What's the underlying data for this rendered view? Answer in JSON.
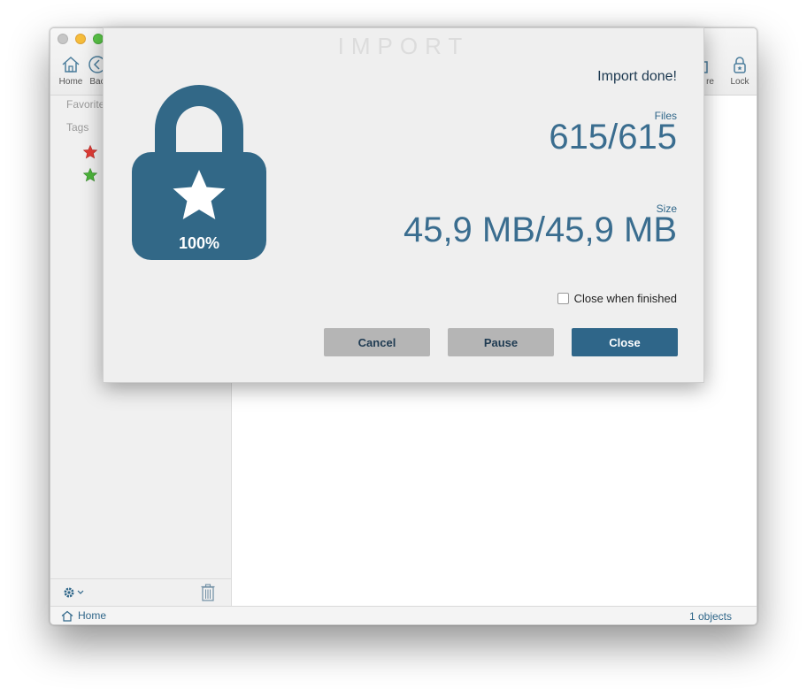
{
  "window": {
    "toolbar": {
      "home_label": "Home",
      "back_label": "Bac",
      "share_label": "re",
      "lock_label": "Lock"
    },
    "sidebar": {
      "favorites_label": "Favorite",
      "tags_label": "Tags",
      "tags": [
        {
          "color": "#e03b35",
          "icon": "star-icon"
        },
        {
          "color": "#4cb43a",
          "icon": "star-icon"
        }
      ]
    },
    "status_bar": {
      "location": "Home",
      "count": "1 objects"
    }
  },
  "import_dialog": {
    "title": "IMPORT",
    "progress_percent": "100%",
    "status": "Import done!",
    "files_label": "Files",
    "files_value": "615/615",
    "size_label": "Size",
    "size_value": "45,9 MB/45,9 MB",
    "close_when_finished_label": "Close when finished",
    "close_when_finished_checked": false,
    "buttons": {
      "cancel": "Cancel",
      "pause": "Pause",
      "close": "Close"
    }
  },
  "colors": {
    "accent": "#2f6689",
    "button_grey": "#b5b5b5"
  }
}
